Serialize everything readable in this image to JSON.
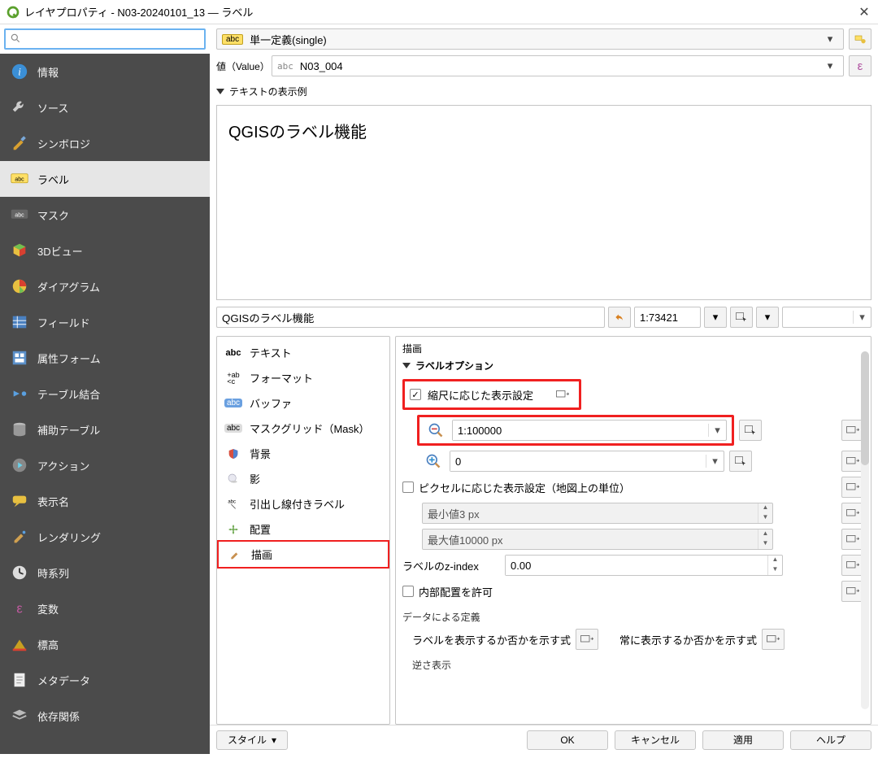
{
  "window": {
    "title": "レイヤプロパティ - N03-20240101_13 — ラベル"
  },
  "search": {
    "placeholder": ""
  },
  "sidebar": {
    "items": [
      {
        "label": "情報"
      },
      {
        "label": "ソース"
      },
      {
        "label": "シンボロジ"
      },
      {
        "label": "ラベル"
      },
      {
        "label": "マスク"
      },
      {
        "label": "3Dビュー"
      },
      {
        "label": "ダイアグラム"
      },
      {
        "label": "フィールド"
      },
      {
        "label": "属性フォーム"
      },
      {
        "label": "テーブル結合"
      },
      {
        "label": "補助テーブル"
      },
      {
        "label": "アクション"
      },
      {
        "label": "表示名"
      },
      {
        "label": "レンダリング"
      },
      {
        "label": "時系列"
      },
      {
        "label": "変数"
      },
      {
        "label": "標高"
      },
      {
        "label": "メタデータ"
      },
      {
        "label": "依存関係"
      }
    ],
    "active_index": 3
  },
  "label_mode": {
    "badge": "abc",
    "text": "単一定義(single)"
  },
  "value_row": {
    "label": "値（Value）",
    "abc": "abc",
    "value": "N03_004"
  },
  "preview": {
    "section": "テキストの表示例",
    "sample": "QGISのラベル機能",
    "input": "QGISのラベル機能",
    "scale": "1:73421"
  },
  "sub_tabs": [
    {
      "label": "テキスト"
    },
    {
      "label": "フォーマット"
    },
    {
      "label": "バッファ"
    },
    {
      "label": "マスクグリッド（Mask）"
    },
    {
      "label": "背景"
    },
    {
      "label": "影"
    },
    {
      "label": "引出し線付きラベル"
    },
    {
      "label": "配置"
    },
    {
      "label": "描画"
    }
  ],
  "render": {
    "title": "描画",
    "section": "ラベルオプション",
    "scale_vis": {
      "label": "縮尺に応じた表示設定",
      "checked": true,
      "min": "1:100000",
      "max": "0"
    },
    "pixel_vis": {
      "label": "ピクセルに応じた表示設定（地図上の単位）",
      "checked": false,
      "min": "最小値3 px",
      "max": "最大値10000 px"
    },
    "zindex": {
      "label": "ラベルのz-index",
      "value": "0.00"
    },
    "inner": {
      "label": "内部配置を許可",
      "checked": false
    },
    "data_def": {
      "title": "データによる定義",
      "show": "ラベルを表示するか否かを示す式",
      "always": "常に表示するか否かを示す式"
    },
    "upside": "逆さ表示"
  },
  "bottom": {
    "style": "スタイル",
    "ok": "OK",
    "cancel": "キャンセル",
    "apply": "適用",
    "help": "ヘルプ"
  }
}
